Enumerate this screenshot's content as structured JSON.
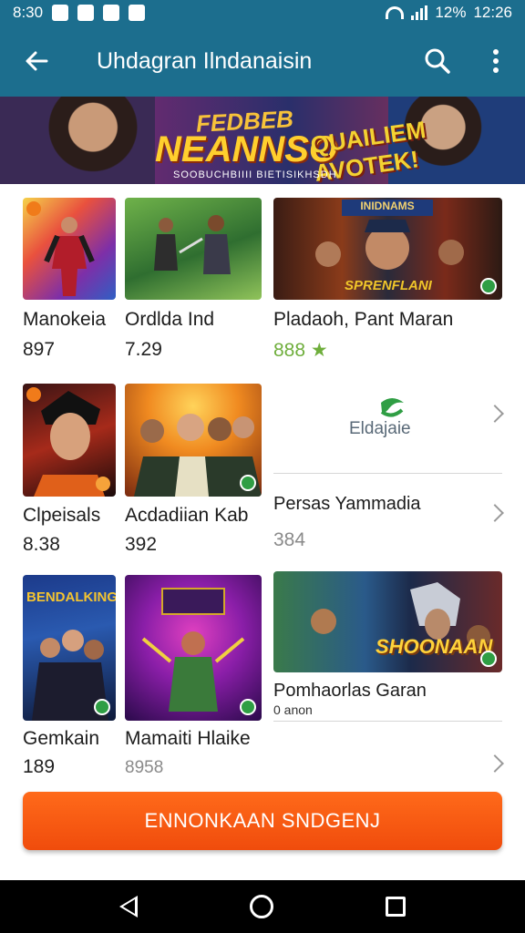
{
  "status_bar": {
    "time": "8:30",
    "right_text": "12%",
    "clock_right": "12:26"
  },
  "app_bar": {
    "title": "Uhdagran Ilndanaisin"
  },
  "banner": {
    "line1": "FEDBEB",
    "line2": "NEANNSO",
    "line3": "QUAILIEM AVOTEK!",
    "tagline": "SOOBUCHBIIII BIETISIKHSDH"
  },
  "grid": [
    {
      "title": "Manokeia",
      "value": "897"
    },
    {
      "title": "Ordlda Ind",
      "value": "7.29"
    },
    {
      "title": "Pladaoh, Pant Maran",
      "value": "888 ★",
      "art_label": "SPRENFLANI",
      "art_top": "INIDNAMS"
    },
    {
      "title": "Clpeisals",
      "value": "8.38"
    },
    {
      "title": "Acdadiian Kab",
      "value": "392"
    },
    {
      "title": "Persas Yammadia",
      "value": "384",
      "logo": "Eldajaie"
    },
    {
      "title": "Gemkain",
      "value": "189",
      "art_label": "BENDALKING"
    },
    {
      "title": "Mamaiti Hlaike",
      "value": "8958"
    },
    {
      "title": "Pomhaorlas Garan",
      "value": "0 anon",
      "art_label": "SHOONAAN"
    }
  ],
  "cta": {
    "label": "ENNONKAAN SNDGENJ"
  },
  "colors": {
    "primary": "#1c6e8e",
    "accent": "#f25a12"
  },
  "icons": [
    "back-arrow-icon",
    "search-icon",
    "more-vert-icon",
    "chevron-right-icon",
    "nav-back-icon",
    "nav-home-icon",
    "nav-recents-icon"
  ]
}
